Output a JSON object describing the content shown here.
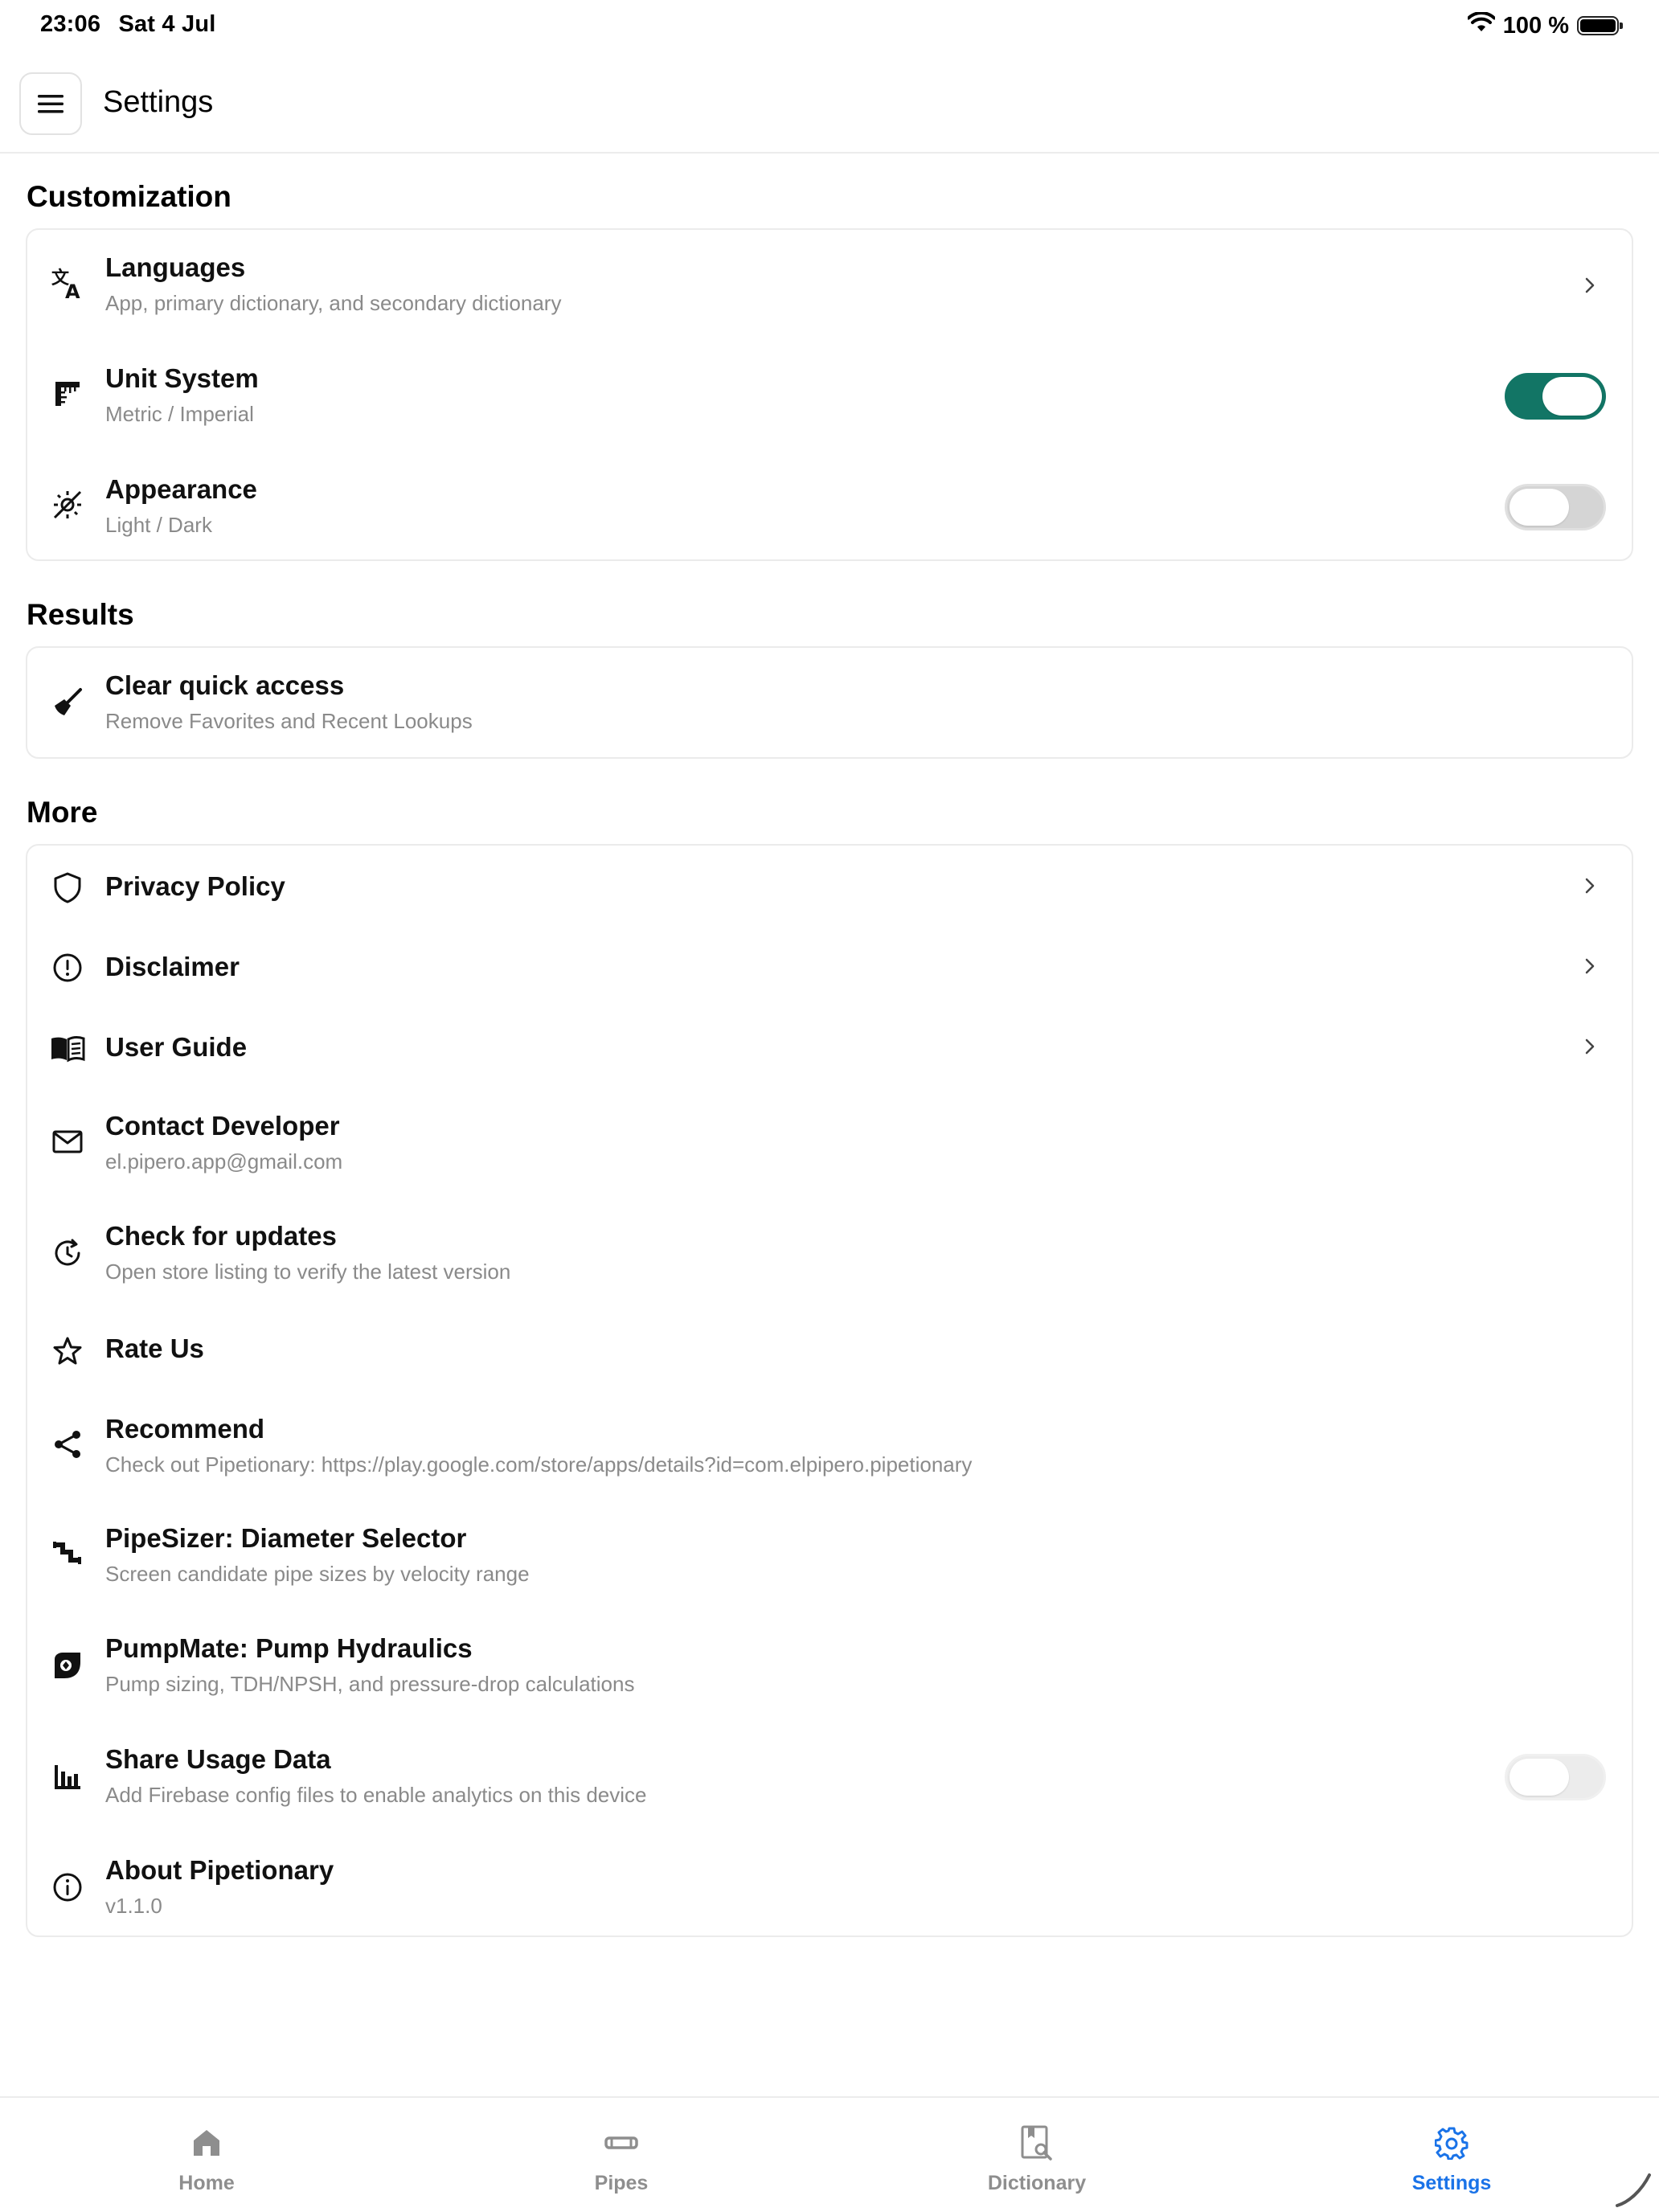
{
  "status_bar": {
    "time": "23:06",
    "date": "Sat 4 Jul",
    "battery": "100 %"
  },
  "app_bar": {
    "title": "Settings",
    "menu_icon": "menu-icon"
  },
  "sections": {
    "customization": "Customization",
    "results": "Results",
    "more": "More"
  },
  "customization": {
    "languages": {
      "title": "Languages",
      "subtitle": "App, primary dictionary, and secondary dictionary",
      "icon": "translate-icon"
    },
    "unit_system": {
      "title": "Unit System",
      "subtitle": "Metric / Imperial",
      "icon": "ruler-icon",
      "toggle": true
    },
    "appearance": {
      "title": "Appearance",
      "subtitle": "Light / Dark",
      "icon": "brightness-icon",
      "toggle": false
    }
  },
  "results": {
    "clear_quick_access": {
      "title": "Clear quick access",
      "subtitle": "Remove Favorites and Recent Lookups",
      "icon": "broom-icon"
    }
  },
  "more": {
    "privacy_policy": {
      "title": "Privacy Policy",
      "icon": "shield-icon"
    },
    "disclaimer": {
      "title": "Disclaimer",
      "icon": "alert-circle-icon"
    },
    "user_guide": {
      "title": "User Guide",
      "icon": "book-icon"
    },
    "contact_developer": {
      "title": "Contact Developer",
      "subtitle": "el.pipero.app@gmail.com",
      "icon": "mail-icon"
    },
    "check_updates": {
      "title": "Check for updates",
      "subtitle": "Open store listing to verify the latest version",
      "icon": "update-icon"
    },
    "rate_us": {
      "title": "Rate Us",
      "icon": "star-icon"
    },
    "recommend": {
      "title": "Recommend",
      "subtitle": "Check out Pipetionary: https://play.google.com/store/apps/details?id=com.elpipero.pipetionary",
      "icon": "share-icon"
    },
    "pipesizer": {
      "title": "PipeSizer: Diameter Selector",
      "subtitle": "Screen candidate pipe sizes by velocity range",
      "icon": "pipe-icon"
    },
    "pumpmate": {
      "title": "PumpMate: Pump Hydraulics",
      "subtitle": "Pump sizing, TDH/NPSH, and pressure-drop calculations",
      "icon": "pump-icon"
    },
    "share_usage": {
      "title": "Share Usage Data",
      "subtitle": "Add Firebase config files to enable analytics on this device",
      "icon": "bar-chart-icon",
      "toggle": false
    },
    "about": {
      "title": "About Pipetionary",
      "subtitle": "v1.1.0",
      "icon": "info-icon"
    }
  },
  "bottom_nav": {
    "home": "Home",
    "pipes": "Pipes",
    "dictionary": "Dictionary",
    "settings": "Settings"
  },
  "colors": {
    "accent_toggle": "#127565",
    "active_tab": "#1a73e8"
  }
}
